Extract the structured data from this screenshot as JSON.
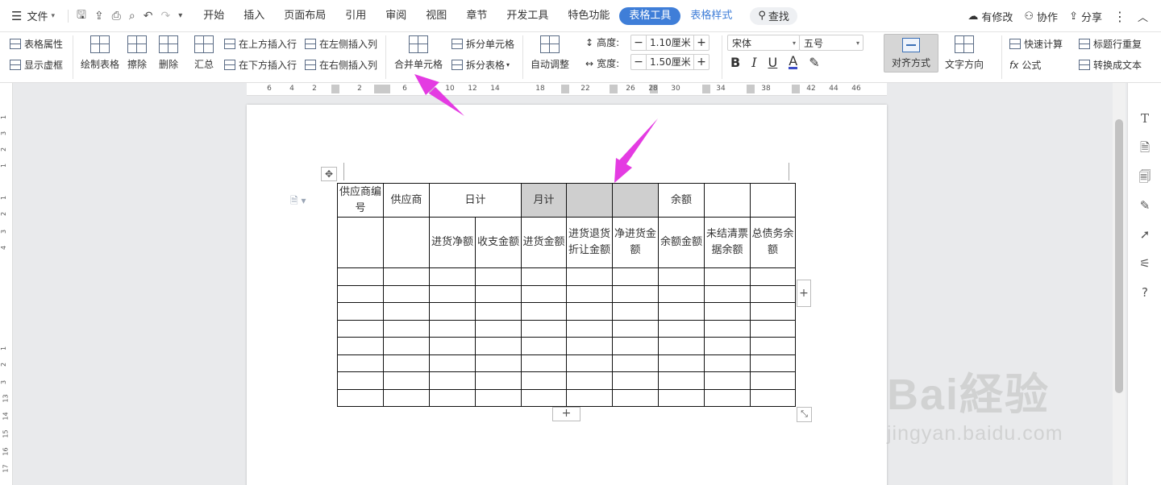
{
  "menubar": {
    "file_label": "文件",
    "tabs": [
      {
        "label": "开始"
      },
      {
        "label": "插入"
      },
      {
        "label": "页面布局"
      },
      {
        "label": "引用"
      },
      {
        "label": "审阅"
      },
      {
        "label": "视图"
      },
      {
        "label": "章节"
      },
      {
        "label": "开发工具"
      },
      {
        "label": "特色功能"
      },
      {
        "label": "表格工具"
      },
      {
        "label": "表格样式"
      }
    ],
    "search_label": "查找",
    "right": {
      "changes": "有修改",
      "collab": "协作",
      "share": "分享"
    }
  },
  "ribbon": {
    "table_props": "表格属性",
    "show_gridlines": "显示虚框",
    "draw_table": "绘制表格",
    "erase": "擦除",
    "delete": "删除",
    "summary": "汇总",
    "insert_above": "在上方插入行",
    "insert_below": "在下方插入行",
    "insert_left": "在左侧插入列",
    "insert_right": "在右侧插入列",
    "merge_cells": "合并单元格",
    "split_cells": "拆分单元格",
    "split_table": "拆分表格",
    "auto_fit": "自动调整",
    "height_label": "高度:",
    "height_value": "1.10厘米",
    "width_label": "宽度:",
    "width_value": "1.50厘米",
    "font_name": "宋体",
    "font_size": "五号",
    "align": "对齐方式",
    "text_direction": "文字方向",
    "quick_calc": "快速计算",
    "repeat_header": "标题行重复",
    "formula": "公式",
    "to_text": "转换成文本"
  },
  "ruler": {
    "h_ticks": [
      "6",
      "4",
      "2",
      "2",
      "6",
      "8",
      "10",
      "12",
      "14",
      "18",
      "22",
      "26",
      "28",
      "30",
      "34",
      "38",
      "42",
      "44",
      "46"
    ],
    "v_ticks": [
      "1",
      "3",
      "2",
      "1",
      "1",
      "2",
      "3",
      "4",
      "1",
      "2",
      "3",
      "13",
      "14",
      "15",
      "16",
      "17"
    ]
  },
  "table": {
    "header_row1": [
      "供应商编号",
      "供应商",
      "日计",
      "月计",
      "",
      "",
      "余额",
      "",
      ""
    ],
    "header_row2": [
      "",
      "",
      "进货净额",
      "收支金额",
      "进货金额",
      "进货退货折让金额",
      "净进货金额",
      "余额金额",
      "未结清票据余额",
      "总债务余额"
    ]
  },
  "watermark": {
    "brand": "Bai経验",
    "url": "jingyan.baidu.com"
  },
  "colors": {
    "accent": "#3f7ed8",
    "arrow": "#e43be2",
    "gray_cell": "#cfcfcf"
  }
}
